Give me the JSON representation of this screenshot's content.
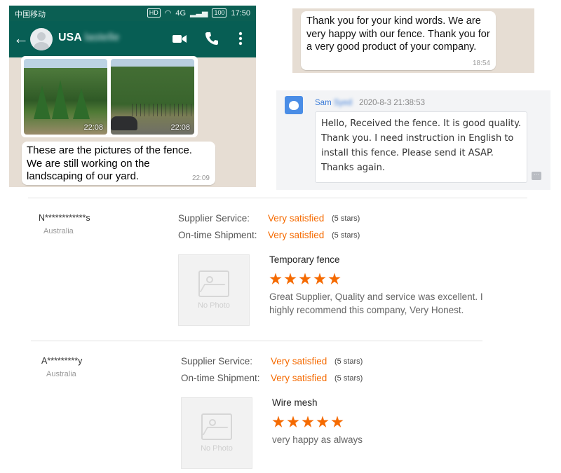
{
  "whatsapp": {
    "status_bar": {
      "carrier": "中国移动",
      "network": "HD",
      "signal": "4G",
      "battery": "100",
      "time": "17:50"
    },
    "contact_name_visible": "USA",
    "contact_name_blurred": "lastelle",
    "photo_times": [
      "22:08",
      "22:08"
    ],
    "message": "These are the pictures of the fence. We are still working on the landscaping of our yard.",
    "message_time": "22:09",
    "icons": [
      "back-arrow-icon",
      "video-call-icon",
      "phone-icon",
      "more-vert-icon"
    ]
  },
  "whatsapp_reply": {
    "message": "Thank you for your kind words. We are very happy with our fence. Thank you for a very good product of your company.",
    "time": "18:54"
  },
  "message_panel": {
    "sender": "Sam",
    "sender_blurred": "Syed",
    "timestamp": "2020-8-3 21:38:53",
    "message": "Hello, Received the fence. It is good quality. Thank you. I need instruction in English to install this fence. Please send it ASAP. Thanks again.",
    "more_label": "···"
  },
  "reviews": [
    {
      "buyer": "N************s",
      "country": "Australia",
      "service_label": "Supplier Service:",
      "service_value": "Very satisfied",
      "service_stars": "(5 stars)",
      "shipment_label": "On-time Shipment:",
      "shipment_value": "Very satisfied",
      "shipment_stars": "(5 stars)",
      "photo_placeholder": "No Photo",
      "product": "Temporary fence",
      "rating": 5,
      "comment": "Great Supplier, Quality and service was excellent. I highly recommend this company, Very Honest."
    },
    {
      "buyer": "A*********y",
      "country": "Australia",
      "service_label": "Supplier Service:",
      "service_value": "Very satisfied",
      "service_stars": "(5 stars)",
      "shipment_label": "On-time Shipment:",
      "shipment_value": "Very satisfied",
      "shipment_stars": "(5 stars)",
      "photo_placeholder": "No Photo",
      "product": "Wire mesh",
      "rating": 5,
      "comment": "very happy as always"
    }
  ],
  "colors": {
    "whatsapp_green": "#075e54",
    "rating_orange": "#f56a00",
    "link_blue": "#3d7dd8"
  }
}
